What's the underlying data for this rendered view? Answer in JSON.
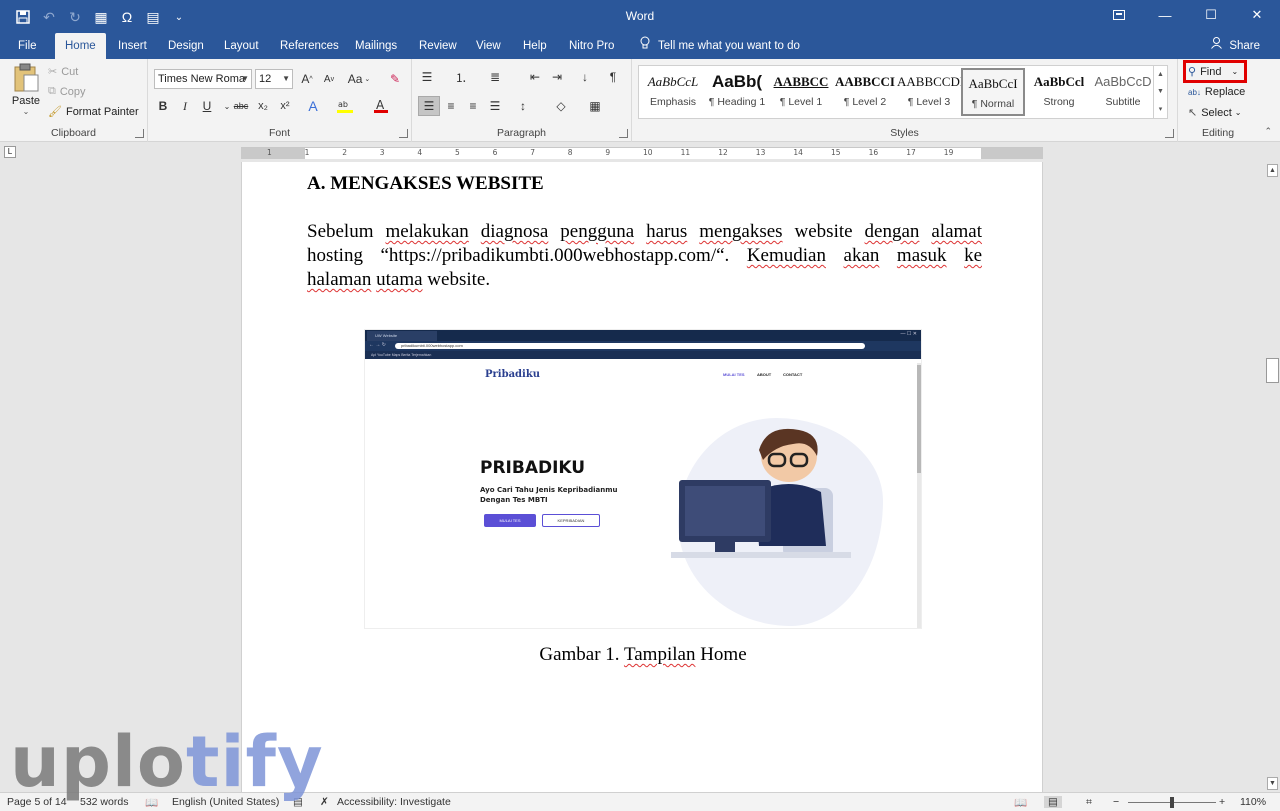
{
  "app": {
    "title": "Word",
    "qat": [
      {
        "name": "save-icon",
        "glyph": "💾"
      },
      {
        "name": "undo-icon",
        "glyph": "↶"
      },
      {
        "name": "redo-icon",
        "glyph": "↻"
      },
      {
        "name": "table-icon",
        "glyph": "▦"
      },
      {
        "name": "omega-icon",
        "glyph": "Ω"
      },
      {
        "name": "document-icon",
        "glyph": "🗎"
      },
      {
        "name": "customize-icon",
        "glyph": "⌄"
      }
    ]
  },
  "tabs": {
    "file": "File",
    "home": "Home",
    "insert": "Insert",
    "design": "Design",
    "layout": "Layout",
    "references": "References",
    "mailings": "Mailings",
    "review": "Review",
    "view": "View",
    "help": "Help",
    "nitro": "Nitro Pro",
    "tell": "Tell me what you want to do",
    "share": "Share"
  },
  "ribbon": {
    "clipboard": {
      "paste": "Paste",
      "cut": "Cut",
      "copy": "Copy",
      "format_painter": "Format Painter",
      "label": "Clipboard"
    },
    "font": {
      "family": "Times New Roma",
      "size": "12",
      "label": "Font",
      "case_label": "Aa",
      "bold": "B",
      "italic": "I",
      "underline": "U",
      "strike": "abc",
      "subscript": "x₂",
      "superscript": "x²",
      "highlight_color": "#ffff00",
      "font_color": "#e00000"
    },
    "paragraph": {
      "label": "Paragraph"
    },
    "styles": {
      "label": "Styles",
      "items": [
        {
          "preview": "AaBbCcL",
          "name": "Emphasis"
        },
        {
          "preview": "AaBb(",
          "name": "¶ Heading 1"
        },
        {
          "preview": "AABBCC",
          "name": "¶ Level 1"
        },
        {
          "preview": "AABBCCI",
          "name": "¶ Level 2"
        },
        {
          "preview": "AABBCCDI",
          "name": "¶ Level 3"
        },
        {
          "preview": "AaBbCcI",
          "name": "¶ Normal"
        },
        {
          "preview": "AaBbCcl",
          "name": "Strong"
        },
        {
          "preview": "AaBbCcD",
          "name": "Subtitle"
        }
      ]
    },
    "editing": {
      "find": "Find",
      "replace": "Replace",
      "select": "Select",
      "label": "Editing"
    }
  },
  "ruler": {
    "ticks": [
      "1",
      "1",
      "2",
      "3",
      "4",
      "5",
      "6",
      "7",
      "8",
      "9",
      "10",
      "11",
      "12",
      "13",
      "14",
      "15",
      "16",
      "17",
      "19"
    ]
  },
  "document": {
    "heading": "A. MENGAKSES WEBSITE",
    "para_plain_1": "Sebelum",
    "para_sq_1": "melakukan",
    "para_sq_2": "diagnosa",
    "para_sq_3": "pengguna",
    "para_sq_4": "harus",
    "para_sq_5": "mengakses",
    "para_plain_2": "website",
    "para_sq_6": "dengan",
    "para_sq_7": "alamat",
    "para_plain_3": "hosting “https://pribadikumbti.000webhostapp.com/“.",
    "para_sq_8": "Kemudian",
    "para_sq_9": "akan",
    "para_sq_10": "masuk",
    "para_sq_11": "ke",
    "para_sq_12": "halaman",
    "para_sq_13": "utama",
    "para_plain_4": "website.",
    "caption_plain": "Gambar 1.",
    "caption_sq": "Tampilan",
    "caption_end": "Home"
  },
  "screenshot": {
    "tab_title": "UW Website",
    "url": "pribadikumbti.000webhostapp.com",
    "bookmarks": "Apl   YouTube   Maps   Berita   Terjemahkan",
    "logo": "Pribadiku",
    "nav": [
      "MULAI TES",
      "ABOUT",
      "CONTACT"
    ],
    "hero_title": "PRIBADIKU",
    "hero_sub": "Ayo Cari Tahu Jenis Kepribadianmu Dengan Tes MBTI",
    "btn_primary": "MULAI TES",
    "btn_secondary": "KEPRIBADIAN",
    "accent": "#5b4fd6"
  },
  "status": {
    "page": "Page 5 of 14",
    "words": "532 words",
    "language": "English (United States)",
    "accessibility": "Accessibility: Investigate",
    "zoom": "110%",
    "zoom_minus": "−",
    "zoom_plus": "+"
  },
  "watermark": {
    "part1": "uplo",
    "part2": "tify"
  }
}
